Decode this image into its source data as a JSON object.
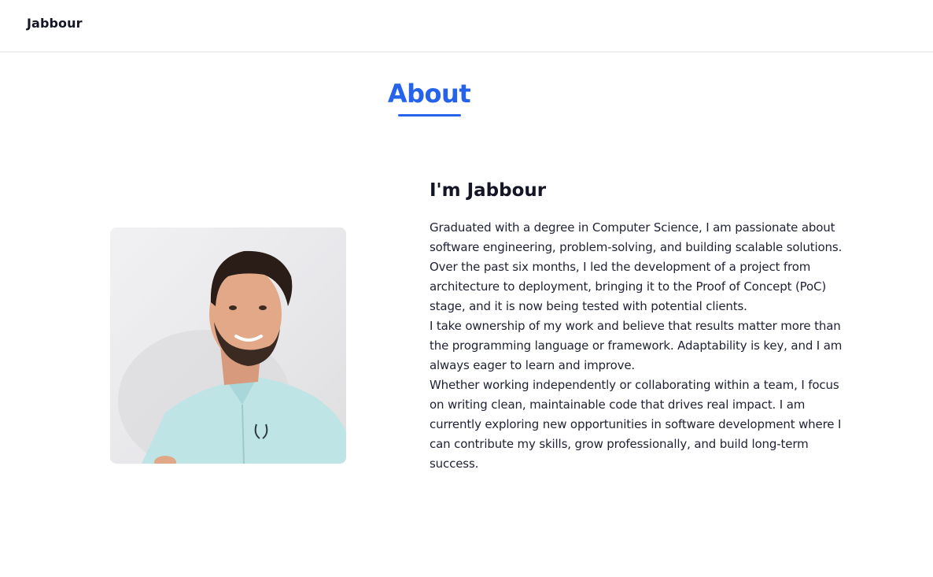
{
  "nav": {
    "brand": "Jabbour"
  },
  "about": {
    "title": "About",
    "heading": "I'm Jabbour",
    "paragraphs": [
      "Graduated with a degree in Computer Science, I am passionate about software engineering, problem-solving, and building scalable solutions. Over the past six months, I led the development of a project from architecture to deployment, bringing it to the Proof of Concept (PoC) stage, and it is now being tested with potential clients.",
      "I take ownership of my work and believe that results matter more than the programming language or framework. Adaptability is key, and I am always eager to learn and improve.",
      "Whether working independently or collaborating within a team, I focus on writing clean, maintainable code that drives real impact. I am currently exploring new opportunities in software development where I can contribute my skills, grow professionally, and build long-term success."
    ],
    "photo_icon": "profile-photo"
  },
  "colors": {
    "accent": "#2563eb",
    "text": "#141626",
    "border": "#f1f1f4"
  }
}
